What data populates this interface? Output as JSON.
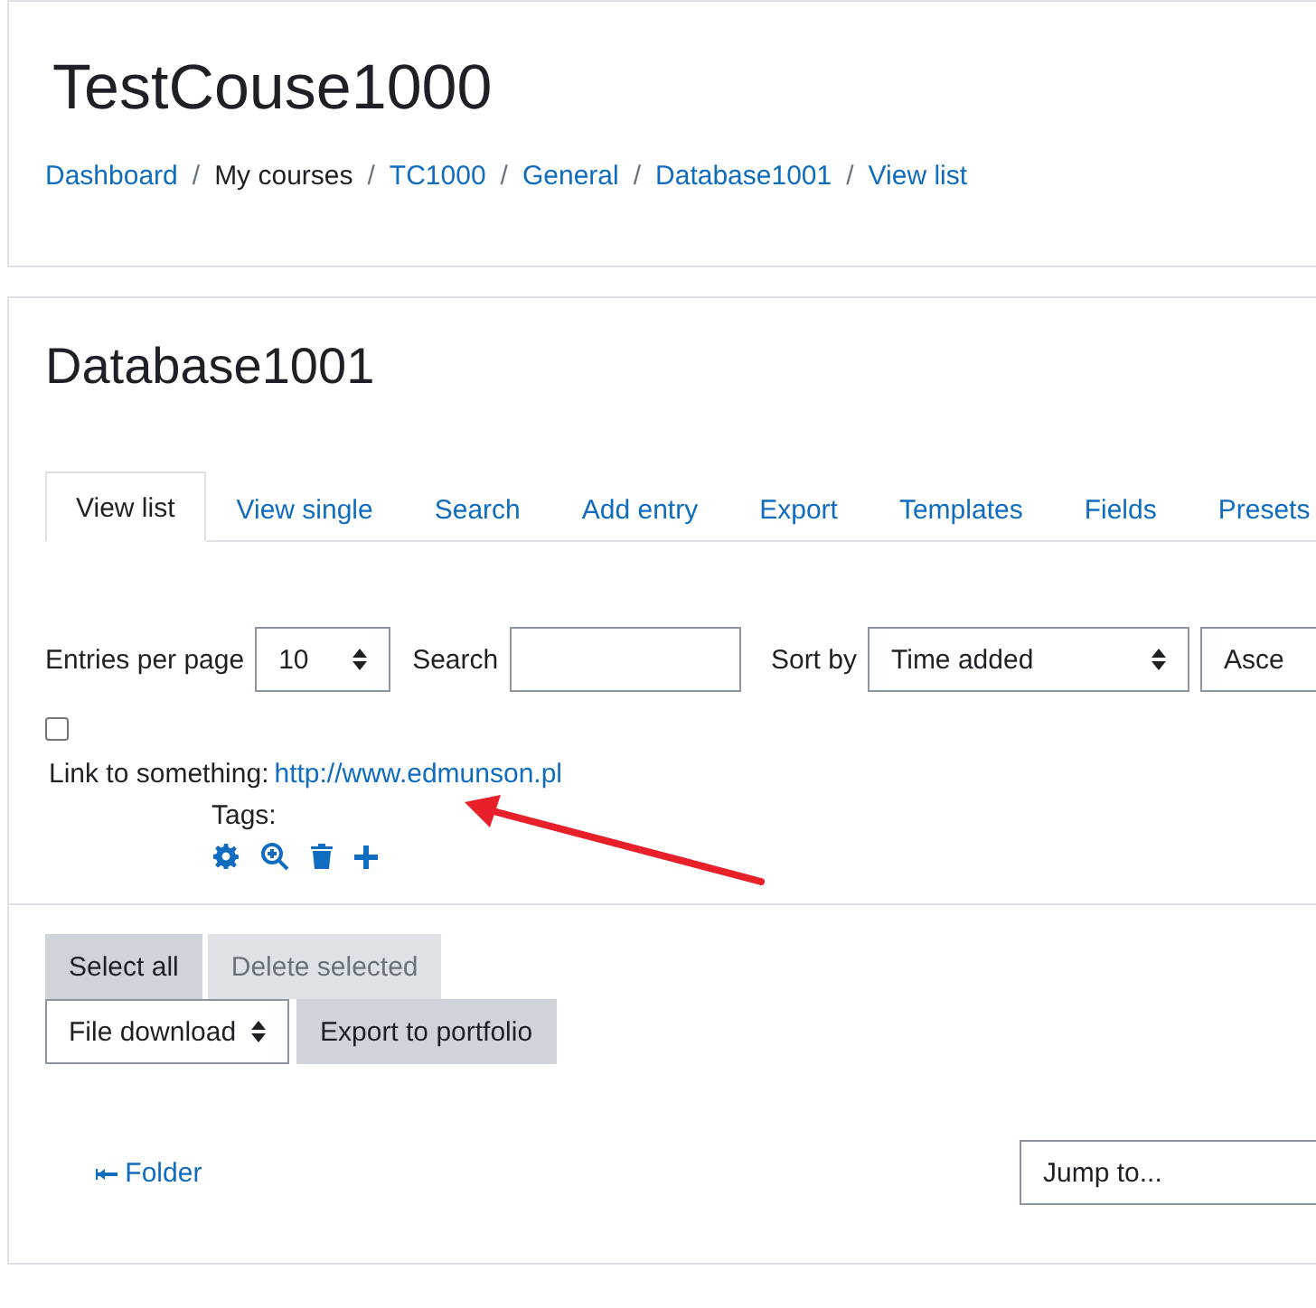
{
  "header": {
    "course_title": "TestCouse1000",
    "breadcrumb": [
      {
        "label": "Dashboard",
        "link": true
      },
      {
        "separator": "/",
        "label": "My courses",
        "link": false
      },
      {
        "separator": "/",
        "label": "TC1000",
        "link": true
      },
      {
        "separator": "/",
        "label": "General",
        "link": true
      },
      {
        "separator": "/",
        "label": "Database1001",
        "link": true
      },
      {
        "separator": "/",
        "label": "View list",
        "link": true
      }
    ]
  },
  "activity_title": "Database1001",
  "tabs": [
    {
      "label": "View list",
      "selected": true
    },
    {
      "label": "View single",
      "selected": false
    },
    {
      "label": "Search",
      "selected": false
    },
    {
      "label": "Add entry",
      "selected": false
    },
    {
      "label": "Export",
      "selected": false
    },
    {
      "label": "Templates",
      "selected": false
    },
    {
      "label": "Fields",
      "selected": false
    },
    {
      "label": "Presets",
      "selected": false
    }
  ],
  "controls": {
    "per_page_label": "Entries per page",
    "per_page_value": "10",
    "search_label": "Search",
    "sort_label": "Sort by",
    "sort_value": "Time added",
    "order_value": "Asce"
  },
  "entry": {
    "checked": false,
    "field_label": "Link to something:",
    "field_value": "http://www.edmunson.pl",
    "tags_label": "Tags:"
  },
  "buttons": [
    {
      "label": "Select all",
      "disabled": false
    },
    {
      "label": "Delete selected",
      "disabled": true
    }
  ],
  "export": {
    "format": "File download",
    "button": "Export to portfolio"
  },
  "nav": {
    "previous": "Folder",
    "jump_placeholder": "Jump to..."
  }
}
